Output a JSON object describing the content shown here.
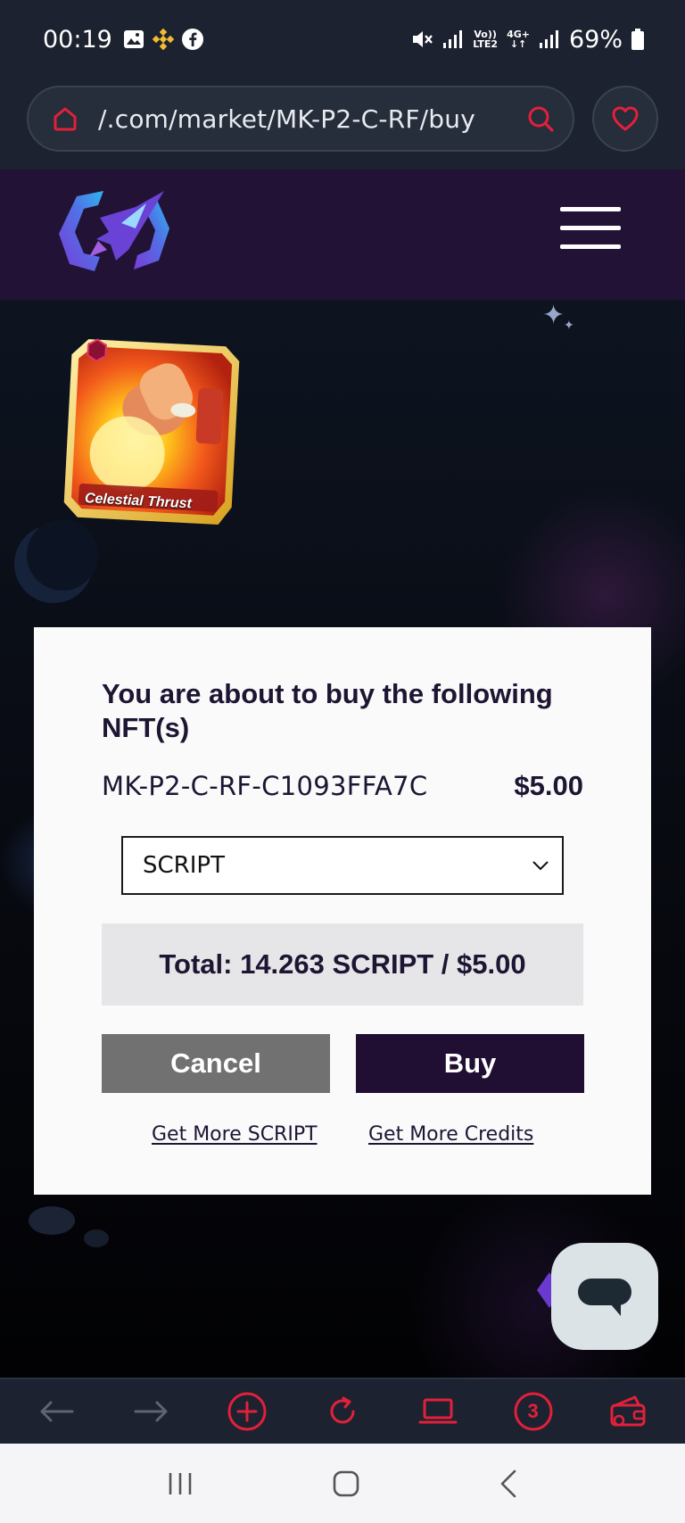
{
  "status_bar": {
    "time": "00:19",
    "network_label_top": "Vo))",
    "network_label_bottom": "LTE2",
    "network_type": "4G+",
    "battery": "69%"
  },
  "browser": {
    "url": "/.com/market/MK-P2-C-RF/buy"
  },
  "nft_card": {
    "name": "Celestial Thrust"
  },
  "modal": {
    "title": "You are about to buy the following NFT(s)",
    "item_id": "MK-P2-C-RF-C1093FFA7C",
    "item_price": "$5.00",
    "currency_selected": "SCRIPT",
    "total": "Total: 14.263 SCRIPT / $5.00",
    "cancel_label": "Cancel",
    "buy_label": "Buy",
    "link_more_script": "Get More SCRIPT",
    "link_more_credits": "Get More Credits"
  },
  "browser_nav": {
    "tab_count": "3"
  },
  "colors": {
    "accent_red": "#e3203a",
    "header_purple": "#221235",
    "buy_button": "#200e33",
    "cancel_button": "#717171"
  }
}
